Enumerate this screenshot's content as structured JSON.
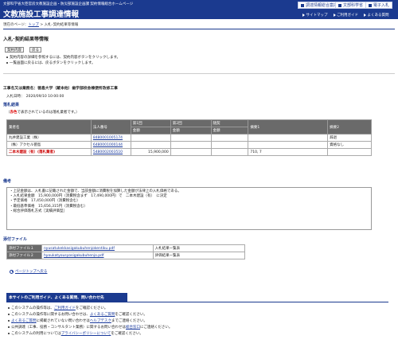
{
  "header": {
    "subtitle": "文部科学省大臣官房文教施設企画・防災部施設企画課 契約情報総合ホームページ",
    "title": "文教施設工事調達情報",
    "buttons": [
      "調達情報総合案内",
      "文部科学省",
      "電子入札"
    ],
    "nav": [
      "サイトマップ",
      "ご利用ガイド",
      "よくある質問"
    ]
  },
  "breadcrumb": {
    "prefix": "現在のページ：",
    "top_link": "トップ",
    "sep": " > ",
    "current": "入札･契約結果等情報"
  },
  "page": {
    "title": "入札･契約結果等情報",
    "buttons": [
      "契約内容",
      "戻る"
    ],
    "instructions": [
      "契約内容の詳細を参照するには、契約内容ボタンをクリックします。",
      "一覧画面に戻るには、戻るボタンをクリックします。"
    ]
  },
  "project": {
    "name": "工事名又は業務名：徳島大学（蔵本他）歯学部校舎棟便所改修工事",
    "date": "入札日時：　2020/09/10 10:00:00"
  },
  "results": {
    "heading": "落札結果",
    "note_pre": "（",
    "note_red": "赤色",
    "note_post": "で表示されているのは落札業者です。）",
    "headers_top": [
      "業者名",
      "法人番号",
      "第1回",
      "第2回",
      "随契",
      "摘要1",
      "摘要2"
    ],
    "headers_sub": [
      "金額",
      "金額",
      "金額"
    ],
    "rows": [
      {
        "name": "丸井建設工業（株）",
        "corp_no": "8480001005174",
        "r1": "",
        "r2": "",
        "zuikei": "",
        "note1": "",
        "note2": "辞退"
      },
      {
        "name": "（株）アクセル徳島",
        "corp_no": "6480001000144",
        "r1": "",
        "r2": "",
        "zuikei": "",
        "note1": "",
        "note2": "資格なし"
      },
      {
        "name": "二本木建設（有）(落札業者)",
        "corp_no": "5480002003510",
        "r1": "15,900,000",
        "r2": "",
        "zuikei": "",
        "note1": "710, 7",
        "note2": ""
      }
    ]
  },
  "remarks": {
    "heading": "備考",
    "lines": [
      "・上記金額は、入札書に記載された金額で、当該金額に消費税を加算した金額が法律上の入札価格である。",
      "・入札結果金額　15,900,000円（消費税含まず　17,490,000円）で　二本木建設（有）　に決定",
      "・予定価格　17,450,000円（消費税含む）",
      "・最低基準価格　15,656,315円（消費税含む）",
      "・総合評価落札方式［実績評価型］"
    ]
  },
  "files": {
    "heading": "添付ファイル",
    "rows": [
      {
        "label": "添付ファイル１",
        "file": "nyusatukekkasigakubuhenjokentiku.pdf",
        "desc": "入札結果一覧表"
      },
      {
        "label": "添付ファイル２",
        "file": "hyoukatyousyosigakubuhenjo.pdf",
        "desc": "評価結果一覧表"
      }
    ]
  },
  "top_link": "ページトップへ戻る",
  "guide": {
    "heading": "本サイトのご利用ガイド、よくある質問、問い合わせ先",
    "items": [
      {
        "pre": "このシステムの操作等は、",
        "link": "ご利用ガイド",
        "post": "をご確認ください。"
      },
      {
        "pre": "このシステムの操作等に関するお問い合わせは、",
        "link": "よくあるご質問",
        "post": "をご確認ください。"
      },
      {
        "pre": "",
        "link": "よくあるご質問",
        "post": "に掲載されていない問い合わせは",
        "link2": "ヘルプデスク",
        "post2": "までご連絡ください。"
      },
      {
        "pre": "公共調達（工事、役務・コンサルタント業務）に関するお問い合わせは",
        "link": "総合窓口",
        "post": "にご連絡ください。"
      },
      {
        "pre": "このシステムの利用については",
        "link": "プライバシーポリシーについて",
        "post": "をご確認ください。"
      }
    ]
  }
}
